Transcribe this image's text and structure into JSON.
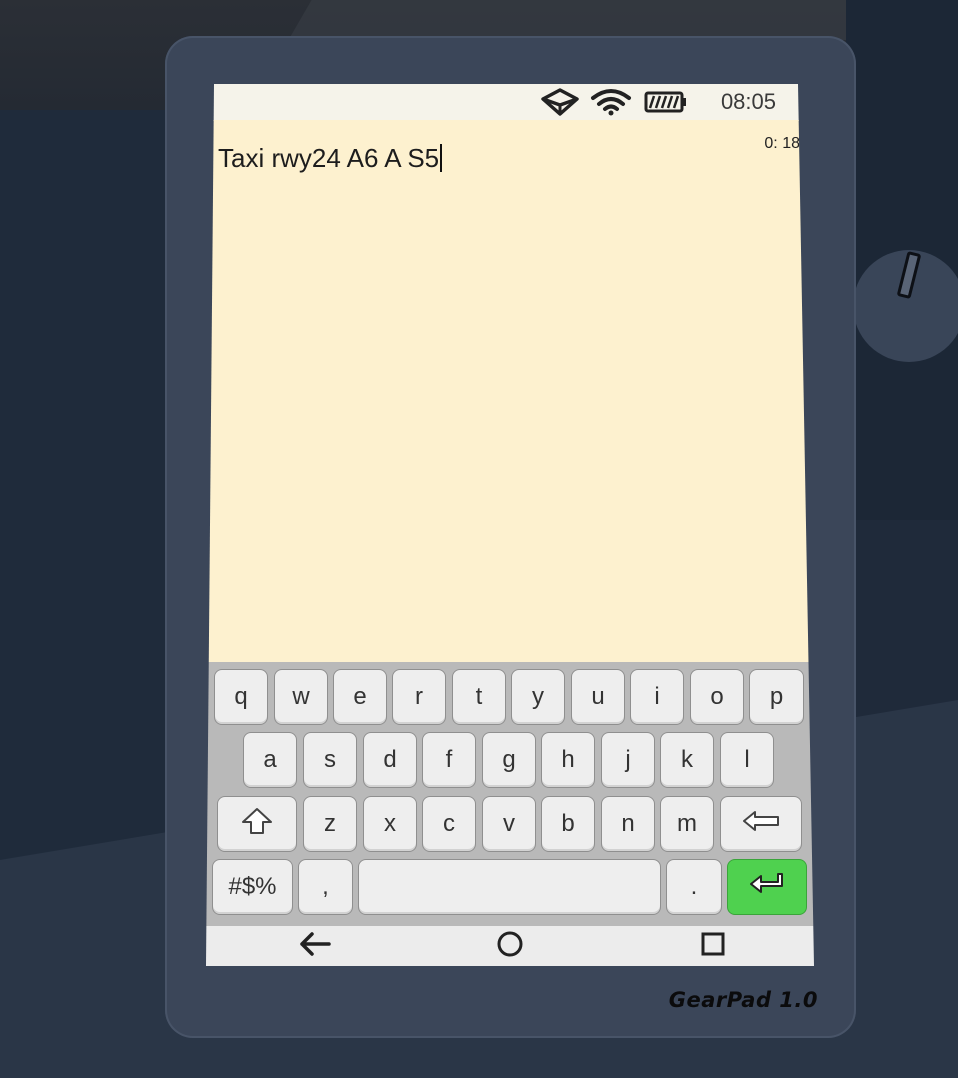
{
  "status_bar": {
    "time": "08:05",
    "icons": [
      "vr-headset-icon",
      "wifi-icon",
      "battery-icon"
    ]
  },
  "note": {
    "counter": "0: 18",
    "text": "Taxi rwy24 A6 A S5"
  },
  "keyboard": {
    "row1": [
      "q",
      "w",
      "e",
      "r",
      "t",
      "y",
      "u",
      "i",
      "o",
      "p"
    ],
    "row2": [
      "a",
      "s",
      "d",
      "f",
      "g",
      "h",
      "j",
      "k",
      "l"
    ],
    "row3": [
      "z",
      "x",
      "c",
      "v",
      "b",
      "n",
      "m"
    ],
    "symbols_label": "#$%",
    "comma_label": ",",
    "period_label": ".",
    "shift_icon": "shift-icon",
    "backspace_icon": "backspace-icon",
    "enter_icon": "enter-icon",
    "enter_color": "#4fd14f"
  },
  "nav": {
    "icons": [
      "back-icon",
      "home-icon",
      "recents-icon"
    ]
  },
  "device": {
    "brand": "GearPad 1.0"
  }
}
